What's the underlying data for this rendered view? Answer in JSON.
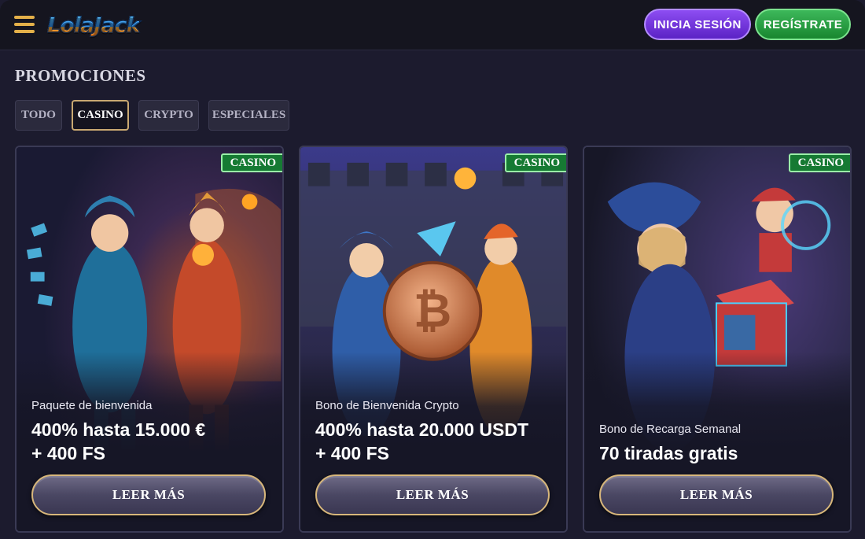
{
  "header": {
    "logo": "LolaJack",
    "login_label": "INICIA SESIÓN",
    "register_label": "REGÍSTRATE"
  },
  "page": {
    "title": "PROMOCIONES"
  },
  "tabs": [
    {
      "label": "TODO",
      "active": false
    },
    {
      "label": "CASINO",
      "active": true
    },
    {
      "label": "CRYPTO",
      "active": false
    },
    {
      "label": "ESPECIALES",
      "active": false
    }
  ],
  "cards": [
    {
      "badge": "CASINO",
      "subtitle": "Paquete de bienvenida",
      "headline_1": "400% hasta 15.000 €",
      "headline_2": "+ 400 FS",
      "button": "LEER MÁS"
    },
    {
      "badge": "CASINO",
      "subtitle": "Bono de Bienvenida Crypto",
      "headline_1": "400% hasta 20.000 USDT",
      "headline_2": "+ 400 FS",
      "button": "LEER MÁS"
    },
    {
      "badge": "CASINO",
      "subtitle": "Bono de Recarga Semanal",
      "headline_1": "70 tiradas gratis",
      "button": "LEER MÁS"
    }
  ],
  "colors": {
    "background": "#1c1b2e",
    "gold_accent": "#e3b049",
    "login_purple": "#7a3be6",
    "register_green": "#2aa047",
    "badge_green": "#167a33"
  }
}
